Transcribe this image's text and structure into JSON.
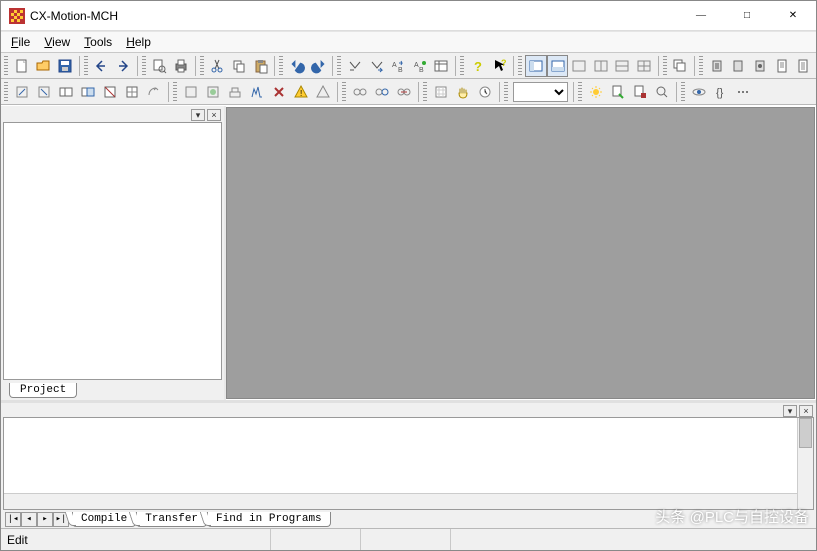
{
  "title": "CX-Motion-MCH",
  "menu": {
    "file": "File",
    "view": "View",
    "tools": "Tools",
    "help": "Help"
  },
  "sidebar": {
    "tab": "Project"
  },
  "output": {
    "tabs": [
      "Compile",
      "Transfer",
      "Find in Programs"
    ]
  },
  "status": {
    "left": "Edit"
  },
  "watermark": "头条 @PLC与自控设备",
  "toolbar1_icons": [
    "new",
    "open",
    "save",
    "arrow-left",
    "arrow-right",
    "print-preview",
    "print",
    "cut",
    "copy",
    "paste",
    "undo",
    "redo",
    "find",
    "find-next",
    "bookmark-prev",
    "bookmark-next",
    "grid",
    "help",
    "context-help",
    "window-1",
    "window-2",
    "w3",
    "w4",
    "w5",
    "w6",
    "stack",
    "mem1",
    "mem2",
    "mem3",
    "doc1",
    "doc2"
  ],
  "toolbar2_icons": [
    "t1",
    "t2",
    "t3",
    "t4",
    "t5",
    "t6",
    "t7",
    "t8",
    "t9",
    "t10",
    "t11",
    "t12",
    "delete",
    "warn",
    "warn2",
    "link1",
    "link2",
    "link3",
    "cal",
    "hand",
    "clock",
    "sun",
    "run",
    "stop",
    "search",
    "watch",
    "brace",
    "dots"
  ]
}
